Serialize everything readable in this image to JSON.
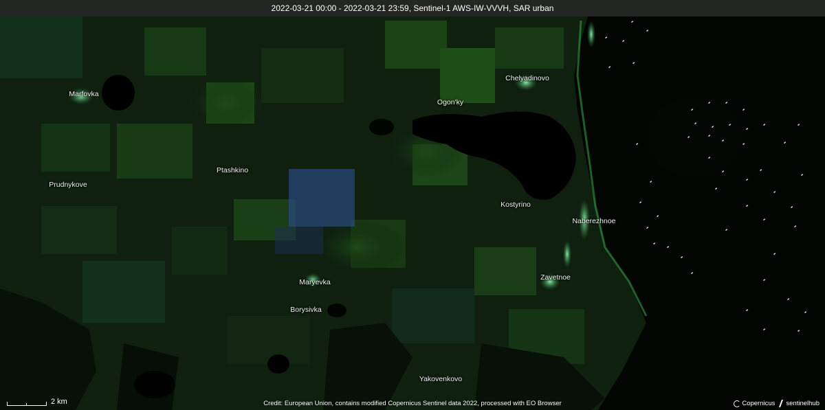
{
  "header": {
    "title": "2022-03-21 00:00 - 2022-03-21 23:59, Sentinel-1 AWS-IW-VVVH, SAR urban"
  },
  "map": {
    "places": [
      {
        "id": "marfovka",
        "name": "Marfovka"
      },
      {
        "id": "ogonky",
        "name": "Ogon'ky"
      },
      {
        "id": "chelyadinovo",
        "name": "Chelyadinovo"
      },
      {
        "id": "ptashkino",
        "name": "Ptashkino"
      },
      {
        "id": "prudnykove",
        "name": "Prudnykove"
      },
      {
        "id": "kostyrino",
        "name": "Kostyrino"
      },
      {
        "id": "naberezhnoe",
        "name": "Naberezhnoe"
      },
      {
        "id": "maryevka",
        "name": "Maryevka"
      },
      {
        "id": "zavetnoe",
        "name": "Zavetnoe"
      },
      {
        "id": "borysivka",
        "name": "Borysivka"
      },
      {
        "id": "yakovenkovo",
        "name": "Yakovenkovo"
      }
    ],
    "colors": {
      "land": "#0d1f0d",
      "field_green": "#1b4a18",
      "urban_bright": "#7fffb0",
      "water": "#000000",
      "blue_patch": "#2c4f8a",
      "ship_points": "#dcd6ff"
    }
  },
  "footer": {
    "scale_label": "2 km",
    "credit": "Credit: European Union, contains modified Copernicus Sentinel data 2022, processed with EO Browser",
    "logo_copernicus": "Copernicus",
    "logo_sentinelhub": "sentinelhub"
  }
}
